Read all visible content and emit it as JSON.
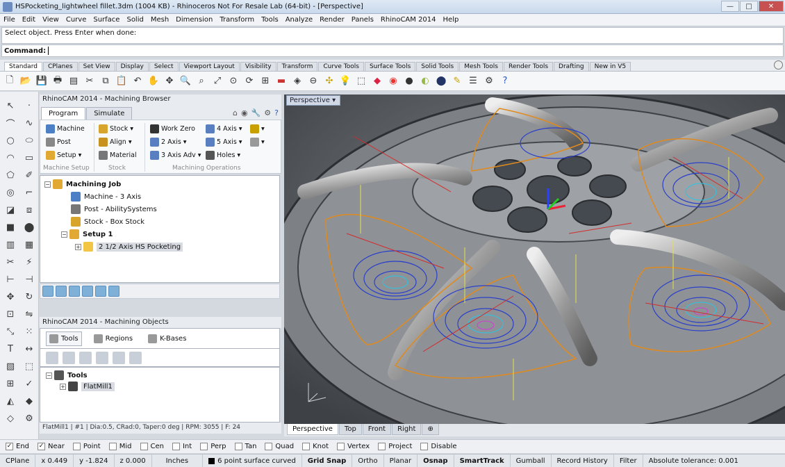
{
  "window": {
    "title": "HSPocketing_lightwheel fillet.3dm (1004 KB) - Rhinoceros Not For Resale Lab (64-bit) - [Perspective]",
    "buttons": [
      "—",
      "□",
      "✕"
    ]
  },
  "menu": [
    "File",
    "Edit",
    "View",
    "Curve",
    "Surface",
    "Solid",
    "Mesh",
    "Dimension",
    "Transform",
    "Tools",
    "Analyze",
    "Render",
    "Panels",
    "RhinoCAM 2014",
    "Help"
  ],
  "command": {
    "history": "Select object. Press Enter when done:",
    "label": "Command:"
  },
  "toolbar_tabs": [
    "Standard",
    "CPlanes",
    "Set View",
    "Display",
    "Select",
    "Viewport Layout",
    "Visibility",
    "Transform",
    "Curve Tools",
    "Surface Tools",
    "Solid Tools",
    "Mesh Tools",
    "Render Tools",
    "Drafting",
    "New in V5"
  ],
  "browser": {
    "title": "RhinoCAM 2014 - Machining Browser",
    "tabs": [
      "Program",
      "Simulate"
    ],
    "ribbon": {
      "machine": "Machine",
      "post": "Post",
      "setup": "Setup ▾",
      "stock": "Stock ▾",
      "align": "Align ▾",
      "material": "Material",
      "work_zero": "Work Zero",
      "two_axis": "2 Axis ▾",
      "three_axis_adv": "3 Axis Adv ▾",
      "four_axis": "4 Axis ▾",
      "five_axis": "5 Axis ▾",
      "holes": "Holes ▾",
      "grp_setup": "Machine Setup",
      "grp_stock": "Stock",
      "grp_ops": "Machining Operations"
    },
    "tree": {
      "job": "Machining Job",
      "machine": "Machine - 3 Axis",
      "post": "Post - AbilitySystems",
      "stock": "Stock - Box Stock",
      "setup": "Setup 1",
      "op": "2 1/2 Axis HS Pocketing"
    }
  },
  "objects": {
    "title": "RhinoCAM 2014 - Machining Objects",
    "tabs": [
      "Tools",
      "Regions",
      "K-Bases"
    ],
    "tree": {
      "root": "Tools",
      "item": "FlatMill1"
    },
    "status": "FlatMill1 | #1 | Dia:0.5, CRad:0, Taper:0 deg | RPM: 3055 | F: 24"
  },
  "viewport": {
    "label": "Perspective ▾",
    "tabs": [
      "Perspective",
      "Top",
      "Front",
      "Right",
      "⊕"
    ]
  },
  "osnap": [
    {
      "label": "End",
      "checked": true
    },
    {
      "label": "Near",
      "checked": true
    },
    {
      "label": "Point",
      "checked": false
    },
    {
      "label": "Mid",
      "checked": false
    },
    {
      "label": "Cen",
      "checked": false
    },
    {
      "label": "Int",
      "checked": false
    },
    {
      "label": "Perp",
      "checked": false
    },
    {
      "label": "Tan",
      "checked": false
    },
    {
      "label": "Quad",
      "checked": false
    },
    {
      "label": "Knot",
      "checked": false
    },
    {
      "label": "Vertex",
      "checked": false
    },
    {
      "label": "Project",
      "checked": false
    },
    {
      "label": "Disable",
      "checked": false
    }
  ],
  "status": {
    "cplane": "CPlane",
    "x": "x 0.449",
    "y": "y -1.824",
    "z": "z 0.000",
    "units": "Inches",
    "layer": "6 point surface curved",
    "grid_snap": "Grid Snap",
    "ortho": "Ortho",
    "planar": "Planar",
    "osnap": "Osnap",
    "smarttrack": "SmartTrack",
    "gumball": "Gumball",
    "record": "Record History",
    "filter": "Filter",
    "tolerance": "Absolute tolerance: 0.001"
  },
  "colors": {
    "toolpath_orange": "#e08a1e",
    "toolpath_blue": "#2a3fc9",
    "toolpath_cyan": "#27c6e6",
    "toolpath_magenta": "#d23ad6",
    "toolpath_red": "#d32b2b",
    "toolpath_yellow": "#e7e04a"
  }
}
